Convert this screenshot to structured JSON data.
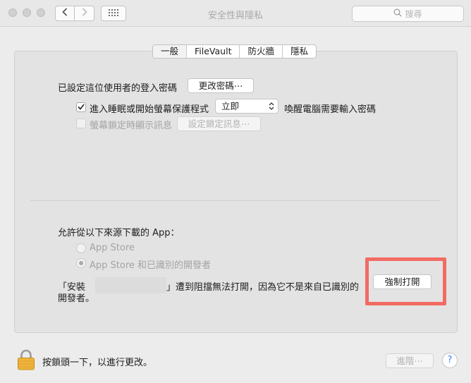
{
  "window": {
    "title": "安全性與隱私",
    "search_placeholder": "搜尋"
  },
  "tabs": [
    {
      "label": "一般",
      "active": true
    },
    {
      "label": "FileVault",
      "active": false
    },
    {
      "label": "防火牆",
      "active": false
    },
    {
      "label": "隱私",
      "active": false
    }
  ],
  "general": {
    "password_label": "已設定這位使用者的登入密碼",
    "change_password_button": "更改密碼⋯",
    "require_password": {
      "checked": true,
      "label_before": "進入睡眠或開始螢幕保護程式",
      "select_value": "立即",
      "label_after": "喚醒電腦需要輸入密碼"
    },
    "lock_message": {
      "checked": false,
      "label": "螢幕鎖定時顯示訊息",
      "button": "設定鎖定訊息⋯"
    }
  },
  "downloads": {
    "heading": "允許從以下來源下載的 App：",
    "options": [
      {
        "label": "App Store",
        "selected": false
      },
      {
        "label": "App Store 和已識別的開發者",
        "selected": true
      }
    ],
    "blocked_prefix": "「安裝",
    "blocked_suffix": "」遭到阻擋無法打開，因為它不是來自已識別的",
    "blocked_line2": "開發者。",
    "open_anyway_button": "強制打開"
  },
  "footer": {
    "lock_text": "按鎖頭一下，以進行更改。",
    "advanced_button": "進階⋯",
    "help_glyph": "?"
  },
  "colors": {
    "highlight": "#f26b63",
    "lock_gold": "#f0b43c"
  }
}
